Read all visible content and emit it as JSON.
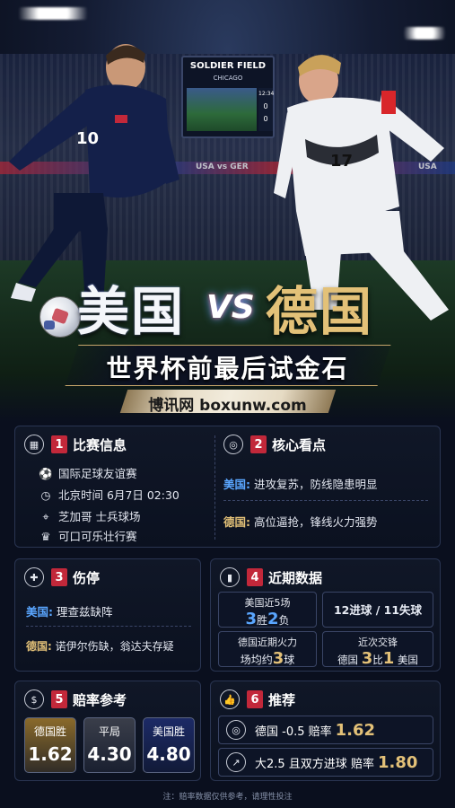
{
  "hero": {
    "stadium_name": "SOLDIER FIELD",
    "stadium_city": "CHICAGO",
    "scoreboard_time": "12:34",
    "score_home": "0",
    "score_away": "0",
    "board_text_1": "USA vs GER",
    "board_text_2": "USA",
    "usa_number": "10",
    "ger_number": "17",
    "title_left": "美国",
    "title_vs": "VS",
    "title_right": "德国",
    "subtitle": "世界杯前最后试金石",
    "site": "博讯网 boxunw.com"
  },
  "match_info": {
    "index": "1",
    "title": "比赛信息",
    "competition": "国际足球友谊赛",
    "time": "北京时间 6月7日 02:30",
    "venue": "芝加哥  士兵球场",
    "event": "可口可乐壮行赛"
  },
  "highlights": {
    "index": "2",
    "title": "核心看点",
    "usa_label": "美国:",
    "usa_text": "进攻复苏，防线隐患明显",
    "ger_label": "德国:",
    "ger_text": "高位逼抢，锋线火力强势"
  },
  "injuries": {
    "index": "3",
    "title": "伤停",
    "usa_label": "美国:",
    "usa_text": "理查兹缺阵",
    "ger_label": "德国:",
    "ger_text": "诺伊尔伤缺，翁达夫存疑"
  },
  "recent": {
    "index": "4",
    "title": "近期数据",
    "usa_last5_label": "美国近5场",
    "usa_wins": "3",
    "usa_wins_unit": "胜",
    "usa_losses": "2",
    "usa_losses_unit": "负",
    "goals": "12进球 / 11失球",
    "ger_form_label": "德国近期火力",
    "ger_avg_prefix": "场均约",
    "ger_avg": "3",
    "ger_avg_unit": "球",
    "h2h_label": "近次交锋",
    "h2h_ger": "德国",
    "h2h_ger_score": "3",
    "h2h_mid": "比",
    "h2h_usa_score": "1",
    "h2h_usa": "美国"
  },
  "odds": {
    "index": "5",
    "title": "赔率参考",
    "items": [
      {
        "label": "德国胜",
        "value": "1.62",
        "color": "#8a6a2a"
      },
      {
        "label": "平局",
        "value": "4.30",
        "color": "#3a3e4a"
      },
      {
        "label": "美国胜",
        "value": "4.80",
        "color": "#1c2a66"
      }
    ]
  },
  "picks": {
    "index": "6",
    "title": "推荐",
    "pick1_text": "德国 -0.5  赔率",
    "pick1_value": "1.62",
    "pick2_text": "大2.5 且双方进球  赔率",
    "pick2_value": "1.80"
  },
  "footer": "注：赔率数据仅供参考，请理性投注",
  "colors": {
    "usa": "#5aa6ff",
    "ger": "#e3c178",
    "accent": "#c2283a"
  }
}
